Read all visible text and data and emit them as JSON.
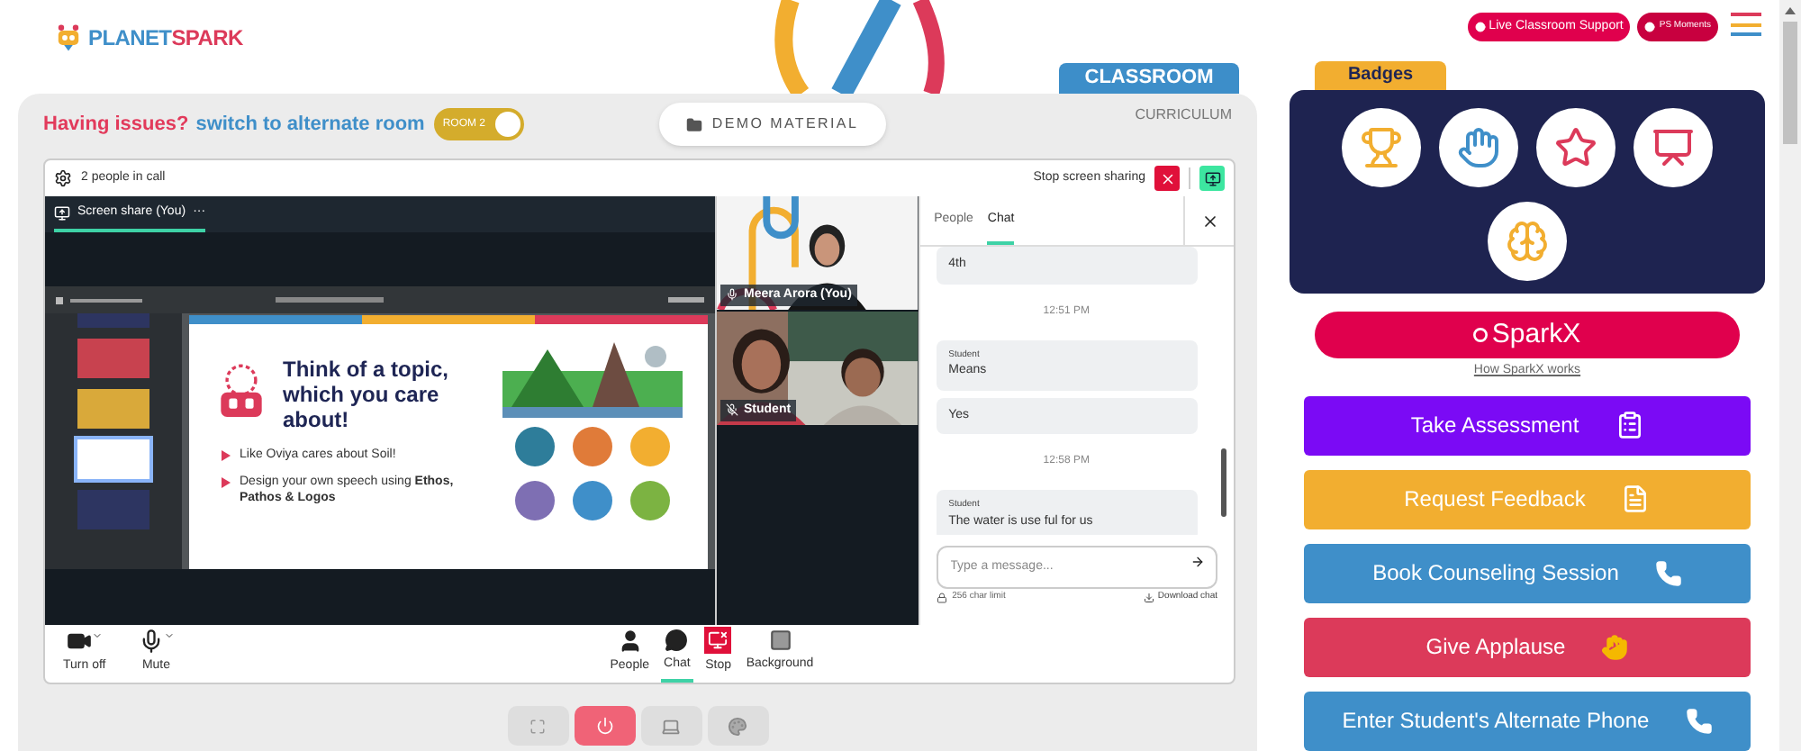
{
  "logo": {
    "first": "PLANET",
    "second": "SPARK"
  },
  "top_buttons": [
    {
      "label": "Live Classroom Support",
      "kind": "support"
    },
    {
      "label": "PS Moments",
      "kind": "moments"
    }
  ],
  "tabs": [
    {
      "label": "CLASSROOM",
      "selected": true
    },
    {
      "label": "CURRICULUM",
      "selected": false
    }
  ],
  "notice": {
    "text": "Having issues?",
    "link": "switch to alternate room"
  },
  "room_toggle": {
    "label": "ROOM 2",
    "on": true
  },
  "demo_button": "DEMO MATERIAL",
  "call": {
    "people": "2 people in call",
    "stop_sharing": "Stop screen sharing",
    "share_tab": "Screen share (You)",
    "share_menu": "···",
    "thumbnails": [
      {
        "selected": false
      },
      {
        "selected": false
      },
      {
        "selected": false
      },
      {
        "selected": true
      },
      {
        "selected": false
      }
    ],
    "slide": {
      "heading": "Think of a topic, which you care about!",
      "bullets": [
        "Like Oviya cares about Soil!",
        "Design your own speech using **Ethos, Pathos & Logos**"
      ]
    },
    "participants": [
      {
        "name": "Meera Arora (You)",
        "muted": false
      },
      {
        "name": "Student",
        "muted": true
      }
    ],
    "chat": {
      "tabs": [
        {
          "label": "People",
          "selected": false
        },
        {
          "label": "Chat",
          "selected": true
        }
      ],
      "messages": [
        {
          "kind": "message",
          "text": "4th"
        },
        {
          "kind": "time",
          "text": "12:51 PM"
        },
        {
          "kind": "message",
          "sender": "Student",
          "text": "Means"
        },
        {
          "kind": "message",
          "text": "Yes"
        },
        {
          "kind": "time",
          "text": "12:58 PM"
        },
        {
          "kind": "message",
          "sender": "Student",
          "text": "The water is use ful for us"
        }
      ],
      "placeholder": "Type a message...",
      "char_limit": "256 char limit",
      "download": "Download chat"
    },
    "controls": [
      {
        "label": "Turn off",
        "kind": "camera",
        "selected": false
      },
      {
        "label": "Mute",
        "kind": "mic",
        "selected": false
      },
      {
        "label": "People",
        "kind": "people",
        "selected": false
      },
      {
        "label": "Chat",
        "kind": "chat",
        "selected": true
      },
      {
        "label": "Stop",
        "kind": "stop",
        "selected": false
      },
      {
        "label": "Background",
        "kind": "background",
        "selected": false
      }
    ]
  },
  "badges": {
    "title": "Badges"
  },
  "sparkx": {
    "label": "SparkX",
    "link": "How SparkX works"
  },
  "actions": [
    {
      "label": "Take Assessment",
      "kind": "clipboard",
      "color": "#7b0af5"
    },
    {
      "label": "Request Feedback",
      "kind": "document",
      "color": "#f2ae30"
    },
    {
      "label": "Book Counseling Session",
      "kind": "phone",
      "color": "#3f8fc9"
    },
    {
      "label": "Give Applause",
      "kind": "clap",
      "color": "#dc3a5a"
    },
    {
      "label": "Enter Student's Alternate Phone",
      "kind": "phone",
      "color": "#3f8fc9"
    }
  ]
}
